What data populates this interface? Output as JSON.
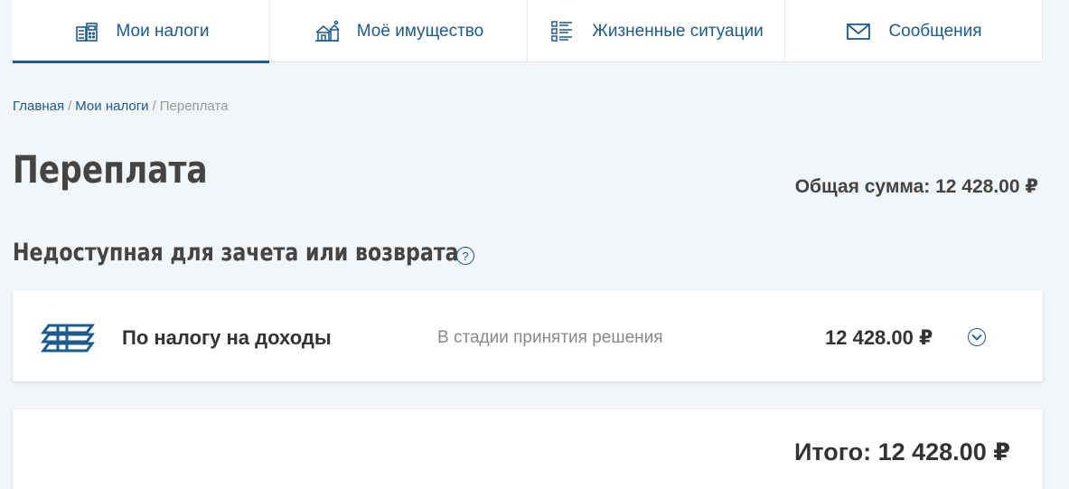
{
  "tabs": [
    {
      "label": "Мои налоги",
      "icon": "calculator-icon",
      "active": true
    },
    {
      "label": "Моё имущество",
      "icon": "property-icon",
      "active": false
    },
    {
      "label": "Жизненные ситуации",
      "icon": "checklist-icon",
      "active": false
    },
    {
      "label": "Сообщения",
      "icon": "envelope-icon",
      "active": false
    }
  ],
  "breadcrumb": {
    "home": "Главная",
    "taxes": "Мои налоги",
    "current": "Переплата",
    "separator": "/"
  },
  "page": {
    "title": "Переплата",
    "total_sum": "Общая сумма: 12 428.00 ₽"
  },
  "section": {
    "title": "Недоступная для зачета или возврата",
    "help_label": "?"
  },
  "overpayment_item": {
    "name": "По налогу на доходы",
    "status": "В стадии принятия решения",
    "amount": "12 428.00 ₽",
    "icon": "income-tax-icon"
  },
  "summary": {
    "total": "Итого: 12 428.00 ₽"
  },
  "colors": {
    "accent": "#1c5a8f",
    "background": "#f2f6f9",
    "text": "#333333",
    "muted": "#8a8a8a"
  }
}
